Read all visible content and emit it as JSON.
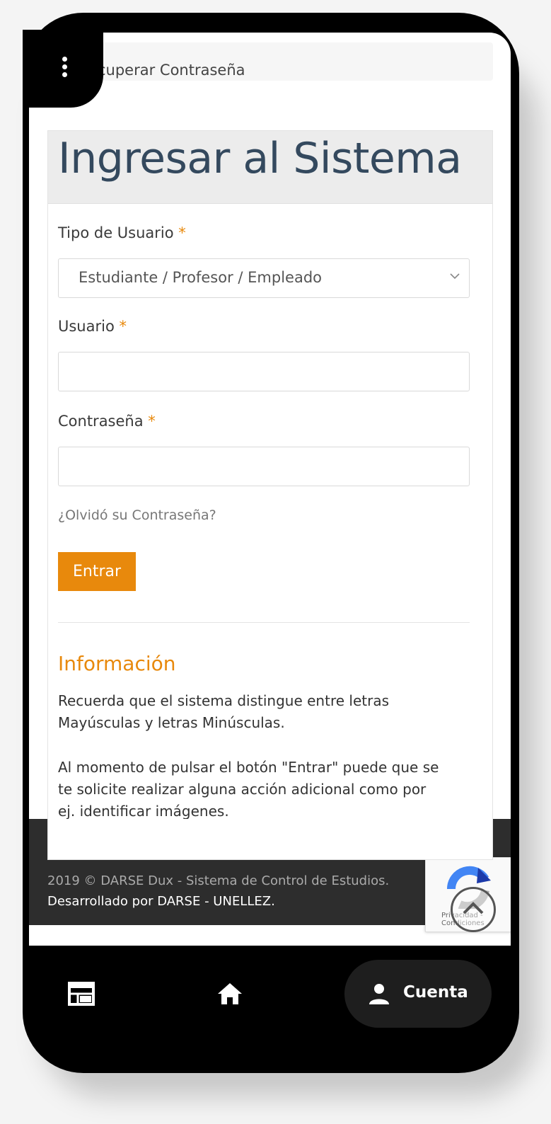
{
  "breadcrumb": {
    "text": "cuperar Contraseña"
  },
  "login_card": {
    "title": "Ingresar al Sistema",
    "user_type_label": "Tipo de Usuario",
    "user_type_selected": "Estudiante / Profesor / Empleado",
    "username_label": "Usuario",
    "username_value": "",
    "password_label": "Contraseña",
    "password_value": "",
    "required_mark": "*",
    "forgot_link": "¿Olvidó su Contraseña?",
    "submit_label": "Entrar"
  },
  "info": {
    "title": "Información",
    "paragraph1_line1": "Recuerda que el sistema distingue entre letras",
    "paragraph1_line2": "Mayúsculas y letras Minúsculas.",
    "paragraph2_line1": "Al momento de pulsar el botón \"Entrar\" puede que se",
    "paragraph2_line2": "te solicite realizar alguna acción adicional como por",
    "paragraph2_line3": "ej. identificar imágenes."
  },
  "footer": {
    "line1": "2019 © DARSE Dux - Sistema de Control de Estudios.",
    "line2": "Desarrollado por DARSE - UNELLEZ."
  },
  "recaptcha": {
    "line1": "Privacidad -",
    "line2": "Condiciones"
  },
  "bottom_nav": {
    "items": [
      {
        "icon": "calendar-icon"
      },
      {
        "icon": "home-icon"
      },
      {
        "icon": "person-icon",
        "label": "Cuenta"
      }
    ]
  },
  "colors": {
    "accent": "#e8890c",
    "title": "#34495e",
    "footer": "#2d2d2d"
  }
}
